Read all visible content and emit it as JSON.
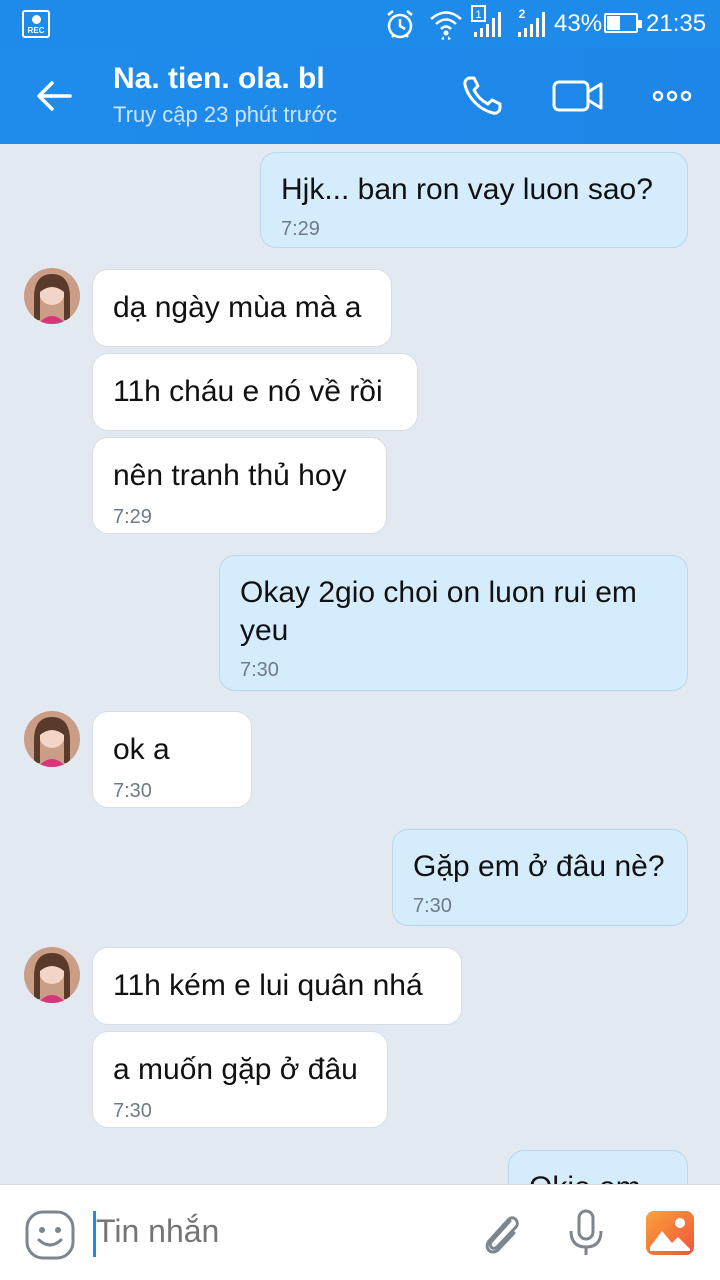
{
  "status_bar": {
    "rec_label": "REC",
    "sim1": "1",
    "sim2": "2",
    "battery": "43%",
    "battery_level": 0.43,
    "time": "21:35"
  },
  "header": {
    "contact_name": "Na. tien. ola. bl",
    "last_seen": "Truy cập 23 phút trước",
    "back_icon": "back-arrow-icon",
    "call_icon": "phone-icon",
    "video_icon": "video-camera-icon",
    "more_icon": "more-dots-icon"
  },
  "messages": [
    {
      "side": "out",
      "text": "Hjk... ban ron vay luon sao?",
      "time": "7:29"
    },
    {
      "side": "in",
      "text": "dạ ngày mùa mà a",
      "avatar": true
    },
    {
      "side": "in",
      "text": "11h cháu e nó về rồi"
    },
    {
      "side": "in",
      "text": "nên tranh thủ hoy",
      "time": "7:29"
    },
    {
      "side": "out",
      "text": "Okay 2gio choi on luon rui em yeu",
      "time": "7:30"
    },
    {
      "side": "in",
      "text": "ok a",
      "time": "7:30",
      "avatar": true
    },
    {
      "side": "out",
      "text": "Gặp em ở đâu nè?",
      "time": "7:30"
    },
    {
      "side": "in",
      "text": "11h kém e lui quân nhá",
      "avatar": true
    },
    {
      "side": "in",
      "text": "a muốn gặp ở đâu",
      "time": "7:30"
    },
    {
      "side": "out",
      "text": "Okie em"
    }
  ],
  "input_bar": {
    "placeholder": "Tin nhắn",
    "emoji_icon": "emoji-icon",
    "attach_icon": "paperclip-icon",
    "mic_icon": "microphone-icon",
    "image_icon": "image-gallery-icon",
    "image_icon_color": "#f26a3d"
  },
  "colors": {
    "header": "#1e8bea",
    "outgoing_bubble": "#d5ecfd",
    "incoming_bubble": "#ffffff",
    "chat_background": "#e2e9f1"
  }
}
